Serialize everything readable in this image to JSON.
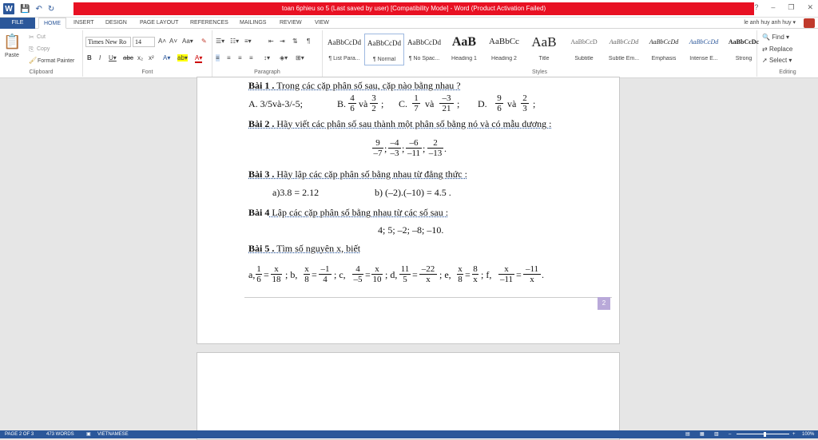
{
  "title": {
    "text": "toan 6phieu so 5 (Last saved by user) [Compatibility Mode] - Word (Product Activation Failed)",
    "help": "?",
    "minimize": "–",
    "restore": "❐",
    "close": "✕"
  },
  "tabs": [
    {
      "label": "FILE"
    },
    {
      "label": "HOME"
    },
    {
      "label": "INSERT"
    },
    {
      "label": "DESIGN"
    },
    {
      "label": "PAGE LAYOUT"
    },
    {
      "label": "REFERENCES"
    },
    {
      "label": "MAILINGS"
    },
    {
      "label": "REVIEW"
    },
    {
      "label": "VIEW"
    }
  ],
  "user": {
    "name": "le anh huy anh huy ▾"
  },
  "clipboard": {
    "paste": "Paste",
    "cut": "Cut",
    "copy": "Copy",
    "format_painter": "Format Painter",
    "label": "Clipboard"
  },
  "font": {
    "name": "Times New Ro",
    "size": "14",
    "label": "Font"
  },
  "paragraph": {
    "label": "Paragraph"
  },
  "styles": {
    "items": [
      {
        "preview": "AaBbCcDd",
        "name": "¶ List Para..."
      },
      {
        "preview": "AaBbCcDd",
        "name": "¶ Normal"
      },
      {
        "preview": "AaBbCcDd",
        "name": "¶ No Spac..."
      },
      {
        "preview": "AaB",
        "name": "Heading 1"
      },
      {
        "preview": "AaBbCc",
        "name": "Heading 2"
      },
      {
        "preview": "AaB",
        "name": "Title"
      },
      {
        "preview": "AaBbCcD",
        "name": "Subtitle"
      },
      {
        "preview": "AaBbCcDd",
        "name": "Subtle Em..."
      },
      {
        "preview": "AaBbCcDd",
        "name": "Emphasis"
      },
      {
        "preview": "AaBbCcDd",
        "name": "Intense E..."
      },
      {
        "preview": "AaBbCcDc",
        "name": "Strong"
      }
    ],
    "label": "Styles"
  },
  "editing": {
    "find": "Find ▾",
    "replace": "Replace",
    "select": "Select ▾",
    "label": "Editing"
  },
  "doc": {
    "b1_label": "Bài 1 .",
    "b1_text": " Trong các cặp phân số sau, cặp nào bằng nhau ?",
    "b1_a": "A. 3/5và-3/-5;",
    "b1_b": "B.",
    "b1_c": "C.",
    "b1_d": "D.",
    "va": "và",
    "semi": ";",
    "b2_label": "Bài 2 .",
    "b2_text": " Hãy viết các phân số sau thành một phân số bằng nó và có mẫu dương :",
    "b3_label": "Bài 3 .",
    "b3_text": " Hãy lập các cặp phân số bằng nhau từ đẳng thức :",
    "b3_a": "a)3.8 = 2.12",
    "b3_b": "b) (–2).(–10) = 4.5 .",
    "b4_label": "Bài 4",
    "b4_text": "  Lập các cặp phân số bằng nhau từ các số sau :",
    "b4_nums": "4; 5; –2; –8; –10.",
    "b5_label": "Bài 5 .",
    "b5_text": " Tìm số nguyên  x, biết",
    "b5_a": "a,",
    "b5_b": ";  b,",
    "b5_c": ";  c,",
    "b5_d": "; d,",
    "b5_e": ";  e,",
    "b5_f": ";  f,",
    "eq": "=",
    "dot": ".",
    "page_num": "2"
  },
  "fractions": {
    "b1_b1": {
      "n": "4",
      "d": "6"
    },
    "b1_b2": {
      "n": "3",
      "d": "2"
    },
    "b1_c1": {
      "n": "1",
      "d": "7"
    },
    "b1_c2": {
      "n": "–3",
      "d": "21"
    },
    "b1_d1": {
      "n": "9",
      "d": "6"
    },
    "b1_d2": {
      "n": "2",
      "d": "3"
    },
    "b2_1": {
      "n": "9",
      "d": "–7"
    },
    "b2_2": {
      "n": "–4",
      "d": "–3"
    },
    "b2_3": {
      "n": "–6",
      "d": "–11"
    },
    "b2_4": {
      "n": "2",
      "d": "–13"
    },
    "b5_a1": {
      "n": "1",
      "d": "6"
    },
    "b5_a2": {
      "n": "x",
      "d": "18"
    },
    "b5_b1": {
      "n": "x",
      "d": "8"
    },
    "b5_b2": {
      "n": "–1",
      "d": "4"
    },
    "b5_c1": {
      "n": "4",
      "d": "–5"
    },
    "b5_c2": {
      "n": "x",
      "d": "10"
    },
    "b5_d1": {
      "n": "11",
      "d": "5"
    },
    "b5_d2": {
      "n": "–22",
      "d": "x"
    },
    "b5_e1": {
      "n": "x",
      "d": "8"
    },
    "b5_e2": {
      "n": "8",
      "d": "x"
    },
    "b5_f1": {
      "n": "x",
      "d": "–11"
    },
    "b5_f2": {
      "n": "–11",
      "d": "x"
    }
  },
  "status": {
    "page": "PAGE 2 OF 3",
    "words": "473 WORDS",
    "lang": "VIETNAMESE",
    "zoom": "100%"
  },
  "colors": {
    "accent": "#2b579a",
    "alert": "#e81123"
  }
}
